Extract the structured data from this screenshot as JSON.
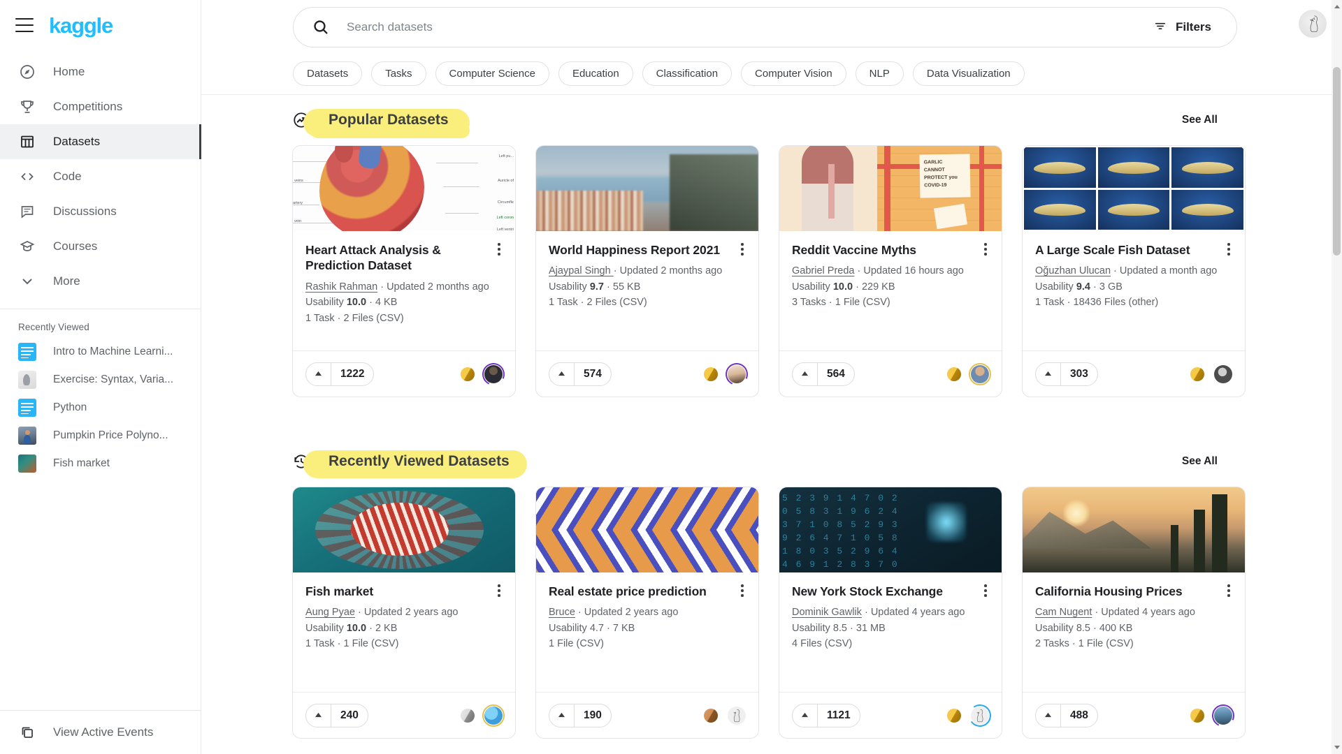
{
  "brand": {
    "name": "kaggle",
    "color": "#20BEFF"
  },
  "sidebar": {
    "menu_icon": "hamburger-icon",
    "nav": [
      {
        "label": "Home",
        "icon": "compass-icon",
        "active": false
      },
      {
        "label": "Competitions",
        "icon": "trophy-icon",
        "active": false
      },
      {
        "label": "Datasets",
        "icon": "table-icon",
        "active": true
      },
      {
        "label": "Code",
        "icon": "code-brackets-icon",
        "active": false
      },
      {
        "label": "Discussions",
        "icon": "comment-icon",
        "active": false
      },
      {
        "label": "Courses",
        "icon": "graduation-cap-icon",
        "active": false
      },
      {
        "label": "More",
        "icon": "chevron-down-icon",
        "active": false
      }
    ],
    "recent_heading": "Recently Viewed",
    "recent": [
      {
        "label": "Intro to Machine Learni...",
        "thumb": "notebook-blue-icon"
      },
      {
        "label": "Exercise: Syntax, Varia...",
        "thumb": "goose-gray-icon"
      },
      {
        "label": "Python",
        "thumb": "notebook-blue-icon"
      },
      {
        "label": "Pumpkin Price Polyno...",
        "thumb": "person-photo-icon"
      },
      {
        "label": "Fish market",
        "thumb": "fish-photo-icon"
      }
    ],
    "footer": {
      "label": "View Active Events",
      "icon": "events-copy-icon"
    }
  },
  "topbar": {
    "search": {
      "placeholder": "Search datasets",
      "value": "",
      "icon": "search-icon"
    },
    "filters": {
      "label": "Filters",
      "icon": "filter-lines-icon"
    },
    "avatar": {
      "name": "user-avatar",
      "alt": "goose-avatar"
    },
    "chips": [
      "Datasets",
      "Tasks",
      "Computer Science",
      "Education",
      "Classification",
      "Computer Vision",
      "NLP",
      "Data Visualization"
    ]
  },
  "sections": [
    {
      "id": "popular",
      "title": "Popular Datasets",
      "icon": "trending-up-circle-icon",
      "highlighted": true,
      "see_all": "See All",
      "cards": [
        {
          "title": "Heart Attack Analysis & Prediction Dataset",
          "author": "Rashik Rahman",
          "updated": "Updated 2 months ago",
          "usability_label": "Usability",
          "usability": "10.0",
          "size": "4 KB",
          "files": "1 Task · 2 Files (CSV)",
          "votes": "1222",
          "medal": "gold",
          "avatar": "pic-dark",
          "ring": "purple",
          "thumb": "heart-anatomy-diagram"
        },
        {
          "title": "World Happiness Report 2021",
          "author": "Ajaypal Singh ",
          "updated": "Updated 2 months ago",
          "usability_label": "Usability",
          "usability": "9.7",
          "size": "55 KB",
          "files": "1 Task · 2 Files (CSV)",
          "votes": "574",
          "medal": "gold",
          "avatar": "pic-man",
          "ring": "purple",
          "thumb": "coastal-town-photo"
        },
        {
          "title": "Reddit Vaccine Myths",
          "author": "Gabriel Preda",
          "updated": "Updated 16 hours ago",
          "usability_label": "Usability",
          "usability": "10.0",
          "size": "229 KB",
          "files": "3 Tasks · 1 File (CSV)",
          "votes": "564",
          "medal": "gold",
          "avatar": "pic-man2",
          "ring": "gold",
          "thumb": "garlic-covid-illustration"
        },
        {
          "title": "A Large Scale Fish Dataset",
          "author": "Oğuzhan Ulucan",
          "updated": "Updated a month ago",
          "usability_label": "Usability",
          "usability": "9.4",
          "size": "3 GB",
          "files": "1 Task · 18436 Files (other)",
          "votes": "303",
          "medal": "gold",
          "avatar": "pic-gray",
          "ring": "none",
          "thumb": "fish-grid-photos"
        }
      ]
    },
    {
      "id": "recently-viewed",
      "title": "Recently Viewed Datasets",
      "icon": "history-clock-icon",
      "highlighted": true,
      "see_all": "See All",
      "cards": [
        {
          "title": "Fish market",
          "author": "Aung Pyae",
          "updated": "Updated 2 years ago",
          "usability_label": "Usability",
          "usability": "10.0",
          "size": "2 KB",
          "files": "1 Task · 1 File (CSV)",
          "votes": "240",
          "medal": "silver",
          "avatar": "pic-earth",
          "ring": "gold",
          "thumb": "lionfish-photo"
        },
        {
          "title": "Real estate price prediction",
          "author": "Bruce",
          "updated": "Updated 2 years ago",
          "usability_label": "Usability",
          "usability": "4.7",
          "size": "7 KB",
          "files": "1 File (CSV)",
          "votes": "190",
          "medal": "bronze",
          "avatar": "pic-goose",
          "ring": "none",
          "thumb": "chevron-pattern"
        },
        {
          "title": "New York Stock Exchange",
          "author": "Dominik Gawlik",
          "updated": "Updated 4 years ago",
          "usability_label": "Usability",
          "usability": "8.5",
          "size": "31 MB",
          "files": "4 Files (CSV)",
          "votes": "1121",
          "medal": "gold",
          "avatar": "pic-goose",
          "ring": "blue",
          "thumb": "stock-numbers-photo"
        },
        {
          "title": "California Housing Prices",
          "author": "Cam Nugent",
          "updated": "Updated 4 years ago",
          "usability_label": "Usability",
          "usability": "8.5",
          "size": "400 KB",
          "files": "2 Tasks · 1 File (CSV)",
          "votes": "488",
          "medal": "gold",
          "avatar": "pic-mount",
          "ring": "purple",
          "thumb": "mountain-forest-photo"
        }
      ]
    }
  ],
  "heart_labels": {
    "l1": "veins",
    "l2": "artery",
    "l3": "vein",
    "r1": "Left pu...",
    "r2": "Auricle of",
    "r3": "Circumfle",
    "r4": "Left coron",
    "r5": "Left ventri"
  }
}
